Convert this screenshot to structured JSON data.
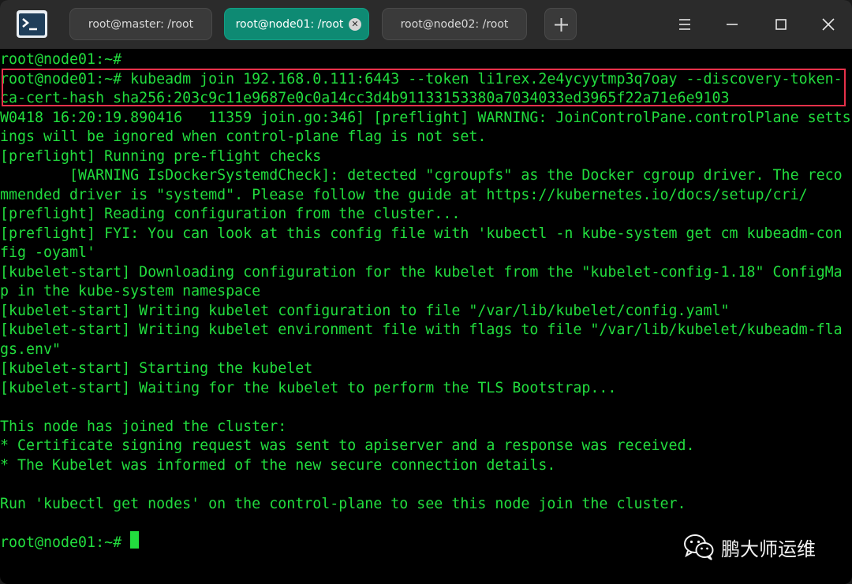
{
  "tabs": [
    {
      "label": "root@master: /root",
      "active": false
    },
    {
      "label": "root@node01: /root",
      "active": true
    },
    {
      "label": "root@node02: /root",
      "active": false
    }
  ],
  "terminal": {
    "lines": [
      "root@node01:~#",
      "root@node01:~# kubeadm join 192.168.0.111:6443 --token li1rex.2e4ycyytmp3q7oay --discovery-token-",
      "ca-cert-hash sha256:203c9c11e9687e0c0a14cc3d4b91133153380a7034033ed3965f22a71e6e9103",
      "W0418 16:20:19.890416   11359 join.go:346] [preflight] WARNING: JoinControlPane.controlPlane setts",
      "ings will be ignored when control-plane flag is not set.",
      "[preflight] Running pre-flight checks",
      "        [WARNING IsDockerSystemdCheck]: detected \"cgroupfs\" as the Docker cgroup driver. The reco",
      "mmended driver is \"systemd\". Please follow the guide at https://kubernetes.io/docs/setup/cri/",
      "[preflight] Reading configuration from the cluster...",
      "[preflight] FYI: You can look at this config file with 'kubectl -n kube-system get cm kubeadm-con",
      "fig -oyaml'",
      "[kubelet-start] Downloading configuration for the kubelet from the \"kubelet-config-1.18\" ConfigMa",
      "p in the kube-system namespace",
      "[kubelet-start] Writing kubelet configuration to file \"/var/lib/kubelet/config.yaml\"",
      "[kubelet-start] Writing kubelet environment file with flags to file \"/var/lib/kubelet/kubeadm-fla",
      "gs.env\"",
      "[kubelet-start] Starting the kubelet",
      "[kubelet-start] Waiting for the kubelet to perform the TLS Bootstrap...",
      "",
      "This node has joined the cluster:",
      "* Certificate signing request was sent to apiserver and a response was received.",
      "* The Kubelet was informed of the new secure connection details.",
      "",
      "Run 'kubectl get nodes' on the control-plane to see this node join the cluster.",
      "",
      "root@node01:~#"
    ]
  },
  "watermark": {
    "text": "鹏大师运维",
    "icon": "wechat-icon"
  },
  "colors": {
    "terminal_text": "#22dd3e",
    "active_tab": "#0e8a73",
    "highlight_border": "#e8314a"
  },
  "icons": {
    "app": "terminal-app-icon",
    "add_tab": "plus-icon",
    "menu": "hamburger-menu-icon",
    "minimize": "minimize-icon",
    "maximize": "maximize-icon",
    "close": "close-icon",
    "tab_close": "tab-close-icon"
  }
}
